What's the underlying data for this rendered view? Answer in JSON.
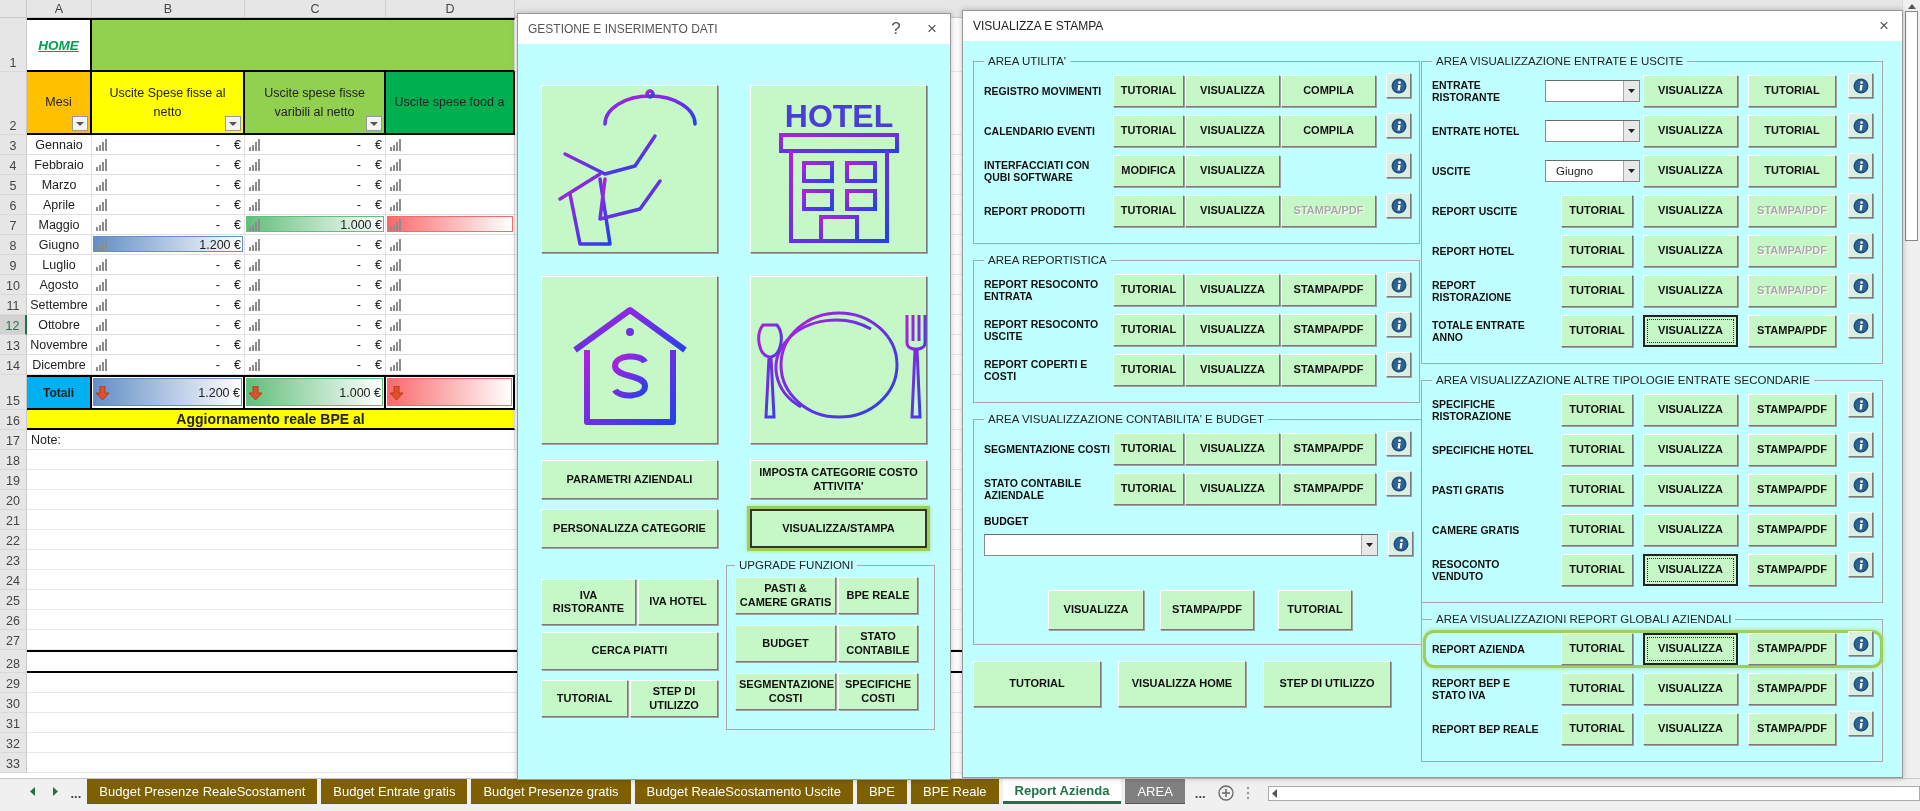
{
  "sheet": {
    "column_letters": [
      "A",
      "B",
      "C",
      "D"
    ],
    "row_numbers": [
      {
        "label": "1",
        "selected": false
      },
      {
        "label": "2",
        "selected": false
      },
      {
        "label": "3",
        "selected": false
      },
      {
        "label": "4",
        "selected": false
      },
      {
        "label": "5",
        "selected": false
      },
      {
        "label": "6",
        "selected": false
      },
      {
        "label": "7",
        "selected": false
      },
      {
        "label": "8",
        "selected": false
      },
      {
        "label": "9",
        "selected": false
      },
      {
        "label": "10",
        "selected": false
      },
      {
        "label": "11",
        "selected": false
      },
      {
        "label": "12",
        "selected": true
      },
      {
        "label": "13",
        "selected": false
      },
      {
        "label": "14",
        "selected": false
      },
      {
        "label": "15",
        "selected": false
      },
      {
        "label": "16",
        "selected": false
      },
      {
        "label": "17",
        "selected": false
      },
      {
        "label": "18",
        "selected": false
      },
      {
        "label": "19",
        "selected": false
      },
      {
        "label": "20",
        "selected": false
      },
      {
        "label": "21",
        "selected": false
      },
      {
        "label": "22",
        "selected": false
      },
      {
        "label": "23",
        "selected": false
      },
      {
        "label": "24",
        "selected": false
      },
      {
        "label": "25",
        "selected": false
      },
      {
        "label": "26",
        "selected": false
      },
      {
        "label": "27",
        "selected": false
      },
      {
        "label": "28",
        "selected": false
      },
      {
        "label": "29",
        "selected": false
      },
      {
        "label": "30",
        "selected": false
      },
      {
        "label": "31",
        "selected": false
      },
      {
        "label": "32",
        "selected": false
      },
      {
        "label": "33",
        "selected": false
      }
    ],
    "home_link": "HOME",
    "headers": [
      {
        "label": "Mesi",
        "color": "#ffc000",
        "filter": true
      },
      {
        "label": "Uscite Spese fisse al netto",
        "color": "#ffff00",
        "filter": true
      },
      {
        "label": "Uscite spese fisse varibili al netto",
        "color": "#92d050",
        "filter": true
      },
      {
        "label": "Uscite spese food a",
        "color": "#00b050",
        "filter": false
      }
    ],
    "months": [
      {
        "month": "Gennaio",
        "cells": [
          {
            "amount": "-",
            "unit": "€",
            "level": 0
          },
          {
            "amount": "-",
            "unit": "€",
            "level": 0
          },
          {
            "level": 0
          }
        ]
      },
      {
        "month": "Febbraio",
        "cells": [
          {
            "amount": "-",
            "unit": "€",
            "level": 0
          },
          {
            "amount": "-",
            "unit": "€",
            "level": 0
          },
          {
            "level": 0
          }
        ]
      },
      {
        "month": "Marzo",
        "cells": [
          {
            "amount": "-",
            "unit": "€",
            "level": 0
          },
          {
            "amount": "-",
            "unit": "€",
            "level": 0
          },
          {
            "level": 0
          }
        ]
      },
      {
        "month": "Aprile",
        "cells": [
          {
            "amount": "-",
            "unit": "€",
            "level": 0
          },
          {
            "amount": "-",
            "unit": "€",
            "level": 0
          },
          {
            "level": 0
          }
        ]
      },
      {
        "month": "Maggio",
        "cells": [
          {
            "amount": "-",
            "unit": "€",
            "level": 0
          },
          {
            "amount": "1.000 €",
            "level": 1,
            "color": "#63be7b"
          },
          {
            "level": 1,
            "color": "#f8696b"
          }
        ]
      },
      {
        "month": "Giugno",
        "cells": [
          {
            "amount": "1.200 €",
            "level": 1,
            "color": "#638ec6"
          },
          {
            "amount": "-",
            "unit": "€",
            "level": 0
          },
          {
            "level": 0
          }
        ]
      },
      {
        "month": "Luglio",
        "cells": [
          {
            "amount": "-",
            "unit": "€",
            "level": 0
          },
          {
            "amount": "-",
            "unit": "€",
            "level": 0
          },
          {
            "level": 0
          }
        ]
      },
      {
        "month": "Agosto",
        "cells": [
          {
            "amount": "-",
            "unit": "€",
            "level": 0
          },
          {
            "amount": "-",
            "unit": "€",
            "level": 0
          },
          {
            "level": 0
          }
        ]
      },
      {
        "month": "Settembre",
        "cells": [
          {
            "amount": "-",
            "unit": "€",
            "level": 0
          },
          {
            "amount": "-",
            "unit": "€",
            "level": 0
          },
          {
            "level": 0
          }
        ]
      },
      {
        "month": "Ottobre",
        "cells": [
          {
            "amount": "-",
            "unit": "€",
            "level": 0
          },
          {
            "amount": "-",
            "unit": "€",
            "level": 0
          },
          {
            "level": 0
          }
        ]
      },
      {
        "month": "Novembre",
        "cells": [
          {
            "amount": "-",
            "unit": "€",
            "level": 0
          },
          {
            "amount": "-",
            "unit": "€",
            "level": 0
          },
          {
            "level": 0
          }
        ]
      },
      {
        "month": "Dicembre",
        "cells": [
          {
            "amount": "-",
            "unit": "€",
            "level": 0
          },
          {
            "amount": "-",
            "unit": "€",
            "level": 0
          },
          {
            "level": 0
          }
        ]
      }
    ],
    "totals": {
      "label": "Totali",
      "cells": [
        {
          "amount": "1.200 €",
          "level": 1,
          "color": "#638ec6"
        },
        {
          "amount": "1.000 €",
          "level": 1,
          "color": "#63be7b"
        },
        {
          "level": 1,
          "color": "#f8696b"
        }
      ]
    },
    "banner": "Aggiornamento reale BPE al",
    "note": "Note:"
  },
  "sheet_tabs": {
    "overflow_left": "...",
    "overflow_right": "...",
    "tabs": [
      {
        "label": "Budget Presenze RealeScostament",
        "color": "#7f6000",
        "selected": false
      },
      {
        "label": "Budget Entrate gratis",
        "color": "#7f6000",
        "selected": false
      },
      {
        "label": "Budget Presenze gratis",
        "color": "#7f6000",
        "selected": false
      },
      {
        "label": "Budget RealeScostamento Uscite",
        "color": "#7f6000",
        "selected": false
      },
      {
        "label": "BPE",
        "color": "#7f6000",
        "selected": false
      },
      {
        "label": "BPE Reale",
        "color": "#7f6000",
        "selected": false
      },
      {
        "label": "Report Azienda",
        "selected": true
      },
      {
        "label": "AREA",
        "color": "#808080",
        "selected": false
      }
    ]
  },
  "manage_dialog": {
    "title": "GESTIONE E INSERIMENTO DATI",
    "help": "?",
    "close": "×",
    "tiles": [
      {
        "kind": "waiter"
      },
      {
        "kind": "hotel",
        "sign": "HOTEL"
      },
      {
        "kind": "house"
      },
      {
        "kind": "plate"
      }
    ],
    "top_rows": [
      [
        {
          "label": "PARAMETRI AZIENDALI",
          "highlighted": false
        },
        {
          "label": "IMPOSTA CATEGORIE COSTO ATTIVITA'",
          "highlighted": false
        }
      ],
      [
        {
          "label": "PERSONALIZZA CATEGORIE",
          "highlighted": false
        },
        {
          "label": "VISUALIZZA/STAMPA",
          "highlighted": true
        }
      ]
    ],
    "left_rows": [
      [
        {
          "label": "IVA RISTORANTE"
        },
        {
          "label": "IVA HOTEL"
        }
      ],
      [
        {
          "label": "CERCA PIATTI"
        }
      ],
      [
        {
          "label": "TUTORIAL"
        },
        {
          "label": "STEP DI UTILIZZO"
        }
      ]
    ],
    "upgrade": {
      "title": "UPGRADE FUNZIONI",
      "rows": [
        [
          {
            "label": "PASTI & CAMERE GRATIS"
          },
          {
            "label": "BPE REALE"
          }
        ],
        [
          {
            "label": "BUDGET"
          },
          {
            "label": "STATO CONTABILE"
          }
        ],
        [
          {
            "label": "SEGMENTAZIONE COSTI"
          },
          {
            "label": "SPECIFICHE COSTI"
          }
        ]
      ]
    }
  },
  "print_dialog": {
    "title": "VISUALIZZA E STAMPA",
    "close": "×",
    "left_sections": [
      {
        "title": "AREA UTILITA'",
        "rows": [
          {
            "label": "REGISTRO MOVIMENTI",
            "buttons": [
              {
                "label": "TUTORIAL",
                "disabled": false
              },
              {
                "label": "VISUALIZZA",
                "disabled": false
              },
              {
                "label": "COMPILA",
                "disabled": false
              }
            ]
          },
          {
            "label": "CALENDARIO EVENTI",
            "buttons": [
              {
                "label": "TUTORIAL",
                "disabled": false
              },
              {
                "label": "VISUALIZZA",
                "disabled": false
              },
              {
                "label": "COMPILA",
                "disabled": false
              }
            ]
          },
          {
            "label": "INTERFACCIATI CON QUBI SOFTWARE",
            "buttons": [
              {
                "label": "MODIFICA",
                "disabled": false
              },
              {
                "label": "VISUALIZZA",
                "disabled": false
              }
            ]
          },
          {
            "label": "REPORT PRODOTTI",
            "buttons": [
              {
                "label": "TUTORIAL",
                "disabled": false
              },
              {
                "label": "VISUALIZZA",
                "disabled": false
              },
              {
                "label": "STAMPA/PDF",
                "disabled": true
              }
            ]
          }
        ]
      },
      {
        "title": "AREA REPORTISTICA",
        "rows": [
          {
            "label": "REPORT RESOCONTO ENTRATA",
            "buttons": [
              {
                "label": "TUTORIAL",
                "disabled": false
              },
              {
                "label": "VISUALIZZA",
                "disabled": false
              },
              {
                "label": "STAMPA/PDF",
                "disabled": false
              }
            ]
          },
          {
            "label": "REPORT RESOCONTO USCITE",
            "buttons": [
              {
                "label": "TUTORIAL",
                "disabled": false
              },
              {
                "label": "VISUALIZZA",
                "disabled": false
              },
              {
                "label": "STAMPA/PDF",
                "disabled": false
              }
            ]
          },
          {
            "label": "REPORT COPERTI E COSTI",
            "buttons": [
              {
                "label": "TUTORIAL",
                "disabled": false
              },
              {
                "label": "VISUALIZZA",
                "disabled": false
              },
              {
                "label": "STAMPA/PDF",
                "disabled": false
              }
            ]
          }
        ]
      },
      {
        "title": "AREA VISUALIZZAZIONE CONTABILITA' E BUDGET",
        "rows": [
          {
            "label": "SEGMENTAZIONE COSTI",
            "buttons": [
              {
                "label": "TUTORIAL",
                "disabled": false
              },
              {
                "label": "VISUALIZZA",
                "disabled": false
              },
              {
                "label": "STAMPA/PDF",
                "disabled": false
              }
            ]
          },
          {
            "label": "STATO CONTABILE AZIENDALE",
            "buttons": [
              {
                "label": "TUTORIAL",
                "disabled": false
              },
              {
                "label": "VISUALIZZA",
                "disabled": false
              },
              {
                "label": "STAMPA/PDF",
                "disabled": false
              }
            ]
          }
        ],
        "budget": {
          "label": "BUDGET",
          "buttons": [
            {
              "label": "VISUALIZZA"
            },
            {
              "label": "STAMPA/PDF"
            },
            {
              "label": "TUTORIAL"
            }
          ]
        }
      }
    ],
    "bottom_buttons": [
      {
        "label": "TUTORIAL"
      },
      {
        "label": "VISUALIZZA HOME"
      },
      {
        "label": "STEP DI UTILIZZO"
      }
    ],
    "right_sections": [
      {
        "title": "AREA VISUALIZZAZIONE ENTRATE E USCITE",
        "rows": [
          {
            "kind": "combo",
            "label": "ENTRATE RISTORANTE",
            "highlighted": false,
            "buttons": [
              {
                "label": "VISUALIZZA",
                "disabled": false,
                "focused": false
              },
              {
                "label": "TUTORIAL",
                "disabled": false,
                "focused": false
              }
            ]
          },
          {
            "kind": "combo",
            "label": "ENTRATE HOTEL",
            "highlighted": false,
            "buttons": [
              {
                "label": "VISUALIZZA",
                "disabled": false,
                "focused": false
              },
              {
                "label": "TUTORIAL",
                "disabled": false,
                "focused": false
              }
            ]
          },
          {
            "kind": "combo",
            "label": "USCITE",
            "combo_value": "Giugno",
            "highlighted": false,
            "buttons": [
              {
                "label": "VISUALIZZA",
                "disabled": false,
                "focused": false
              },
              {
                "label": "TUTORIAL",
                "disabled": false,
                "focused": false
              }
            ]
          },
          {
            "kind": "buttons",
            "label": "REPORT USCITE",
            "highlighted": false,
            "buttons": [
              {
                "label": "TUTORIAL",
                "disabled": false,
                "focused": false
              },
              {
                "label": "VISUALIZZA",
                "disabled": false,
                "focused": false
              },
              {
                "label": "STAMPA/PDF",
                "disabled": true,
                "focused": false
              }
            ]
          },
          {
            "kind": "buttons",
            "label": "REPORT HOTEL",
            "highlighted": false,
            "buttons": [
              {
                "label": "TUTORIAL",
                "disabled": false,
                "focused": false
              },
              {
                "label": "VISUALIZZA",
                "disabled": false,
                "focused": false
              },
              {
                "label": "STAMPA/PDF",
                "disabled": true,
                "focused": false
              }
            ]
          },
          {
            "kind": "buttons",
            "label": "REPORT RISTORAZIONE",
            "highlighted": false,
            "buttons": [
              {
                "label": "TUTORIAL",
                "disabled": false,
                "focused": false
              },
              {
                "label": "VISUALIZZA",
                "disabled": false,
                "focused": false
              },
              {
                "label": "STAMPA/PDF",
                "disabled": true,
                "focused": false
              }
            ]
          },
          {
            "kind": "buttons",
            "label": "TOTALE ENTRATE ANNO",
            "highlighted": false,
            "buttons": [
              {
                "label": "TUTORIAL",
                "disabled": false,
                "focused": false
              },
              {
                "label": "VISUALIZZA",
                "disabled": false,
                "focused": true
              },
              {
                "label": "STAMPA/PDF",
                "disabled": false,
                "focused": false
              }
            ]
          }
        ]
      },
      {
        "title": "AREA VISUALIZZAZIONE ALTRE TIPOLOGIE ENTRATE SECONDARIE",
        "rows": [
          {
            "kind": "buttons",
            "label": "SPECIFICHE RISTORAZIONE",
            "highlighted": false,
            "buttons": [
              {
                "label": "TUTORIAL",
                "disabled": false,
                "focused": false
              },
              {
                "label": "VISUALIZZA",
                "disabled": false,
                "focused": false
              },
              {
                "label": "STAMPA/PDF",
                "disabled": false,
                "focused": false
              }
            ]
          },
          {
            "kind": "buttons",
            "label": "SPECIFICHE HOTEL",
            "highlighted": false,
            "buttons": [
              {
                "label": "TUTORIAL",
                "disabled": false,
                "focused": false
              },
              {
                "label": "VISUALIZZA",
                "disabled": false,
                "focused": false
              },
              {
                "label": "STAMPA/PDF",
                "disabled": false,
                "focused": false
              }
            ]
          },
          {
            "kind": "buttons",
            "label": "PASTI GRATIS",
            "highlighted": false,
            "buttons": [
              {
                "label": "TUTORIAL",
                "disabled": false,
                "focused": false
              },
              {
                "label": "VISUALIZZA",
                "disabled": false,
                "focused": false
              },
              {
                "label": "STAMPA/PDF",
                "disabled": false,
                "focused": false
              }
            ]
          },
          {
            "kind": "buttons",
            "label": "CAMERE GRATIS",
            "highlighted": false,
            "buttons": [
              {
                "label": "TUTORIAL",
                "disabled": false,
                "focused": false
              },
              {
                "label": "VISUALIZZA",
                "disabled": false,
                "focused": false
              },
              {
                "label": "STAMPA/PDF",
                "disabled": false,
                "focused": false
              }
            ]
          },
          {
            "kind": "buttons",
            "label": "RESOCONTO VENDUTO",
            "highlighted": false,
            "buttons": [
              {
                "label": "TUTORIAL",
                "disabled": false,
                "focused": false
              },
              {
                "label": "VISUALIZZA",
                "disabled": false,
                "focused": true
              },
              {
                "label": "STAMPA/PDF",
                "disabled": false,
                "focused": false
              }
            ]
          }
        ]
      },
      {
        "title": "AREA VISUALIZZAZIONI REPORT GLOBALI AZIENDALI",
        "rows": [
          {
            "kind": "buttons",
            "label": "REPORT AZIENDA",
            "highlighted": true,
            "buttons": [
              {
                "label": "TUTORIAL",
                "disabled": false,
                "focused": false
              },
              {
                "label": "VISUALIZZA",
                "disabled": false,
                "focused": true
              },
              {
                "label": "STAMPA/PDF",
                "disabled": false,
                "focused": false
              }
            ]
          },
          {
            "kind": "buttons",
            "label": "REPORT BEP E STATO IVA",
            "highlighted": false,
            "buttons": [
              {
                "label": "TUTORIAL",
                "disabled": false,
                "focused": false
              },
              {
                "label": "VISUALIZZA",
                "disabled": false,
                "focused": false
              },
              {
                "label": "STAMPA/PDF",
                "disabled": false,
                "focused": false
              }
            ]
          },
          {
            "kind": "buttons",
            "label": "REPORT BEP REALE",
            "highlighted": false,
            "buttons": [
              {
                "label": "TUTORIAL",
                "disabled": false,
                "focused": false
              },
              {
                "label": "VISUALIZZA",
                "disabled": false,
                "focused": false
              },
              {
                "label": "STAMPA/PDF",
                "disabled": false,
                "focused": false
              }
            ]
          }
        ]
      }
    ]
  }
}
